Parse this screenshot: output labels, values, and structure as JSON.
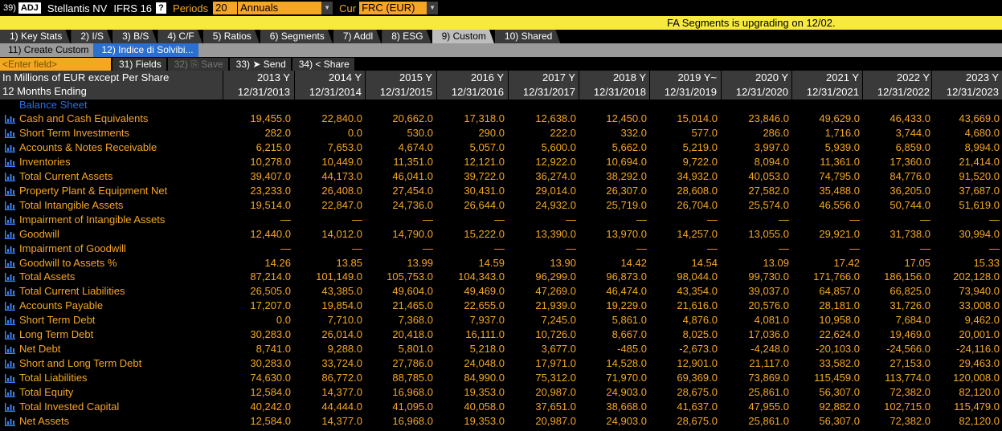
{
  "topbar": {
    "num": "39)",
    "adj": "ADJ",
    "company": "Stellantis NV",
    "standard": "IFRS 16",
    "help": "?",
    "periods_label": "Periods",
    "periods_value": "20",
    "periodicity": "Annuals",
    "cur_label": "Cur",
    "currency": "FRC (EUR)"
  },
  "notice": "FA Segments is upgrading on 12/02.",
  "tabs": [
    "1) Key Stats",
    "2) I/S",
    "3) B/S",
    "4) C/F",
    "5) Ratios",
    "6) Segments",
    "7) Addl",
    "8) ESG",
    "9) Custom",
    "10) Shared"
  ],
  "active_tab": 8,
  "subtabs": [
    "11) Create Custom",
    "12) Indice di Solvibi..."
  ],
  "active_subtab": 1,
  "actions": {
    "enter_field_placeholder": "<Enter field>",
    "fields": "31) Fields",
    "save": "32) ⎘ Save",
    "send": "33) ➤ Send",
    "share": "34) < Share"
  },
  "header": {
    "line1": "In Millions of EUR except Per Share",
    "line2": "12 Months Ending",
    "years": [
      "2013 Y",
      "2014 Y",
      "2015 Y",
      "2016 Y",
      "2017 Y",
      "2018 Y",
      "2019 Y~",
      "2020 Y",
      "2021 Y",
      "2022 Y",
      "2023 Y"
    ],
    "dates": [
      "12/31/2013",
      "12/31/2014",
      "12/31/2015",
      "12/31/2016",
      "12/31/2017",
      "12/31/2018",
      "12/31/2019",
      "12/31/2020",
      "12/31/2021",
      "12/31/2022",
      "12/31/2023"
    ]
  },
  "section": "Balance Sheet",
  "rows": [
    {
      "name": "Cash and Cash Equivalents",
      "values": [
        "19,455.0",
        "22,840.0",
        "20,662.0",
        "17,318.0",
        "12,638.0",
        "12,450.0",
        "15,014.0",
        "23,846.0",
        "49,629.0",
        "46,433.0",
        "43,669.0"
      ]
    },
    {
      "name": "Short Term Investments",
      "values": [
        "282.0",
        "0.0",
        "530.0",
        "290.0",
        "222.0",
        "332.0",
        "577.0",
        "286.0",
        "1,716.0",
        "3,744.0",
        "4,680.0"
      ]
    },
    {
      "name": "Accounts & Notes Receivable",
      "values": [
        "6,215.0",
        "7,653.0",
        "4,674.0",
        "5,057.0",
        "5,600.0",
        "5,662.0",
        "5,219.0",
        "3,997.0",
        "5,939.0",
        "6,859.0",
        "8,994.0"
      ]
    },
    {
      "name": "Inventories",
      "values": [
        "10,278.0",
        "10,449.0",
        "11,351.0",
        "12,121.0",
        "12,922.0",
        "10,694.0",
        "9,722.0",
        "8,094.0",
        "11,361.0",
        "17,360.0",
        "21,414.0"
      ]
    },
    {
      "name": "Total Current Assets",
      "values": [
        "39,407.0",
        "44,173.0",
        "46,041.0",
        "39,722.0",
        "36,274.0",
        "38,292.0",
        "34,932.0",
        "40,053.0",
        "74,795.0",
        "84,776.0",
        "91,520.0"
      ]
    },
    {
      "name": "Property Plant & Equipment Net",
      "values": [
        "23,233.0",
        "26,408.0",
        "27,454.0",
        "30,431.0",
        "29,014.0",
        "26,307.0",
        "28,608.0",
        "27,582.0",
        "35,488.0",
        "36,205.0",
        "37,687.0"
      ]
    },
    {
      "name": "Total Intangible Assets",
      "values": [
        "19,514.0",
        "22,847.0",
        "24,736.0",
        "26,644.0",
        "24,932.0",
        "25,719.0",
        "26,704.0",
        "25,574.0",
        "46,556.0",
        "50,744.0",
        "51,619.0"
      ]
    },
    {
      "name": "Impairment of Intangible Assets",
      "values": [
        "—",
        "—",
        "—",
        "—",
        "—",
        "—",
        "—",
        "—",
        "—",
        "—",
        "—"
      ]
    },
    {
      "name": "Goodwill",
      "values": [
        "12,440.0",
        "14,012.0",
        "14,790.0",
        "15,222.0",
        "13,390.0",
        "13,970.0",
        "14,257.0",
        "13,055.0",
        "29,921.0",
        "31,738.0",
        "30,994.0"
      ]
    },
    {
      "name": "Impairment of Goodwill",
      "values": [
        "—",
        "—",
        "—",
        "—",
        "—",
        "—",
        "—",
        "—",
        "—",
        "—",
        "—"
      ]
    },
    {
      "name": "Goodwill to Assets %",
      "values": [
        "14.26",
        "13.85",
        "13.99",
        "14.59",
        "13.90",
        "14.42",
        "14.54",
        "13.09",
        "17.42",
        "17.05",
        "15.33"
      ]
    },
    {
      "name": "Total Assets",
      "values": [
        "87,214.0",
        "101,149.0",
        "105,753.0",
        "104,343.0",
        "96,299.0",
        "96,873.0",
        "98,044.0",
        "99,730.0",
        "171,766.0",
        "186,156.0",
        "202,128.0"
      ]
    },
    {
      "name": "Total Current Liabilities",
      "values": [
        "26,505.0",
        "43,385.0",
        "49,604.0",
        "49,469.0",
        "47,269.0",
        "46,474.0",
        "43,354.0",
        "39,037.0",
        "64,857.0",
        "66,825.0",
        "73,940.0"
      ]
    },
    {
      "name": "Accounts Payable",
      "values": [
        "17,207.0",
        "19,854.0",
        "21,465.0",
        "22,655.0",
        "21,939.0",
        "19,229.0",
        "21,616.0",
        "20,576.0",
        "28,181.0",
        "31,726.0",
        "33,008.0"
      ]
    },
    {
      "name": "Short Term Debt",
      "values": [
        "0.0",
        "7,710.0",
        "7,368.0",
        "7,937.0",
        "7,245.0",
        "5,861.0",
        "4,876.0",
        "4,081.0",
        "10,958.0",
        "7,684.0",
        "9,462.0"
      ]
    },
    {
      "name": "Long Term Debt",
      "values": [
        "30,283.0",
        "26,014.0",
        "20,418.0",
        "16,111.0",
        "10,726.0",
        "8,667.0",
        "8,025.0",
        "17,036.0",
        "22,624.0",
        "19,469.0",
        "20,001.0"
      ]
    },
    {
      "name": "Net Debt",
      "values": [
        "8,741.0",
        "9,288.0",
        "5,801.0",
        "5,218.0",
        "3,677.0",
        "-485.0",
        "-2,673.0",
        "-4,248.0",
        "-20,103.0",
        "-24,566.0",
        "-24,116.0"
      ]
    },
    {
      "name": "Short and Long Term Debt",
      "values": [
        "30,283.0",
        "33,724.0",
        "27,786.0",
        "24,048.0",
        "17,971.0",
        "14,528.0",
        "12,901.0",
        "21,117.0",
        "33,582.0",
        "27,153.0",
        "29,463.0"
      ]
    },
    {
      "name": "Total Liabilities",
      "values": [
        "74,630.0",
        "86,772.0",
        "88,785.0",
        "84,990.0",
        "75,312.0",
        "71,970.0",
        "69,369.0",
        "73,869.0",
        "115,459.0",
        "113,774.0",
        "120,008.0"
      ]
    },
    {
      "name": "Total Equity",
      "values": [
        "12,584.0",
        "14,377.0",
        "16,968.0",
        "19,353.0",
        "20,987.0",
        "24,903.0",
        "28,675.0",
        "25,861.0",
        "56,307.0",
        "72,382.0",
        "82,120.0"
      ]
    },
    {
      "name": "Total Invested Capital",
      "values": [
        "40,242.0",
        "44,444.0",
        "41,095.0",
        "40,058.0",
        "37,651.0",
        "38,668.0",
        "41,637.0",
        "47,955.0",
        "92,882.0",
        "102,715.0",
        "115,479.0"
      ]
    },
    {
      "name": "Net Assets",
      "values": [
        "12,584.0",
        "14,377.0",
        "16,968.0",
        "19,353.0",
        "20,987.0",
        "24,903.0",
        "28,675.0",
        "25,861.0",
        "56,307.0",
        "72,382.0",
        "82,120.0"
      ]
    }
  ],
  "colors": {
    "accent": "#f5a623",
    "notice": "#f7e93f",
    "section": "#2f6be0",
    "active_subtab": "#2a6fd1",
    "chart_icon": "#3b82f6"
  }
}
